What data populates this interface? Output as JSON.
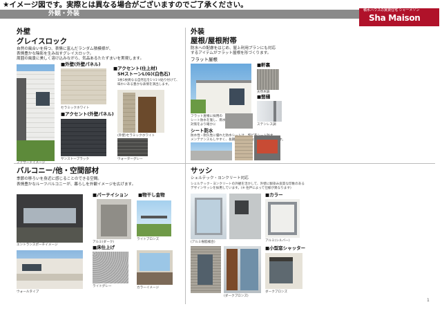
{
  "header": {
    "notice": "★イメージ図です。実際とは異なる場合がございますのでご了承ください。",
    "section_title": "外観・外装",
    "brand_sub": "積水ハウスの賃貸住宅 シャーメゾン",
    "brand_name": "Sha Maison"
  },
  "wall": {
    "heading": "外壁",
    "subheading": "グレイスロック",
    "desc": [
      "自然の風合いを持つ、表情に富んだランダム積模様が、",
      "表情豊かな陰影を生み出すグレイスロック。",
      "周囲の風景に美しく溶け込みながら、気品あるたたずまいを実現します。"
    ],
    "photo_caption": "ファサードイメージ",
    "panel1_label": "■外壁(外壁パネル)",
    "panel1_caption": "セラミックホワイト",
    "panel2_label": "■アクセント(外壁パネル)",
    "panel2_caption": "サンストーブラック",
    "accent_label": "■アクセント(仕上材)",
    "accent_sub": "SHストーンL(G)(白色石)",
    "accent_desc": [
      "1枚1枚異なる自然石を1つ1つ貼り付けて、",
      "味わいある豊かな表情を演出します。"
    ],
    "door_caption": "(外壁)セラミックホワイト",
    "stone_caption": "ウォーターグレー"
  },
  "roof": {
    "heading": "外装",
    "subheading": "屋根/屋根附帯",
    "desc": [
      "防水への配慮をはじめ、屋上利用プランにも対応",
      "するアイテムがフラット屋根を形づくります。"
    ],
    "flat_label": "フラット屋根",
    "eaves_label": "■軒裏",
    "eaves_caption": "天然木調",
    "gutter_label": "■竪樋",
    "gutter_caption": "ステンレス調",
    "flat_note": [
      "フラット屋根に採用の",
      "シート防水を施し、雨水",
      "対策をより確かに"
    ],
    "sheet_label": "シート防水",
    "sheet_desc": [
      "防水性・耐久性に優れた防水シートは、塩ビ系シート防水",
      "メンテナンスもしやすく、長期にわたって防水性能を維持します。"
    ]
  },
  "balcony": {
    "heading": "バルコニー/他・空間部材",
    "desc": [
      "季節の移ろいを身近に感じることのできる空間。",
      "表情豊かなルーフバルコニーが、暮らしを外観イメージを広げます。"
    ],
    "caption1": "エントランスポーチイメージ",
    "partition_label": "■パーテイション",
    "partition_caption": "アルミ(ダーク)",
    "fixture_label": "■物干し金物",
    "fixture_caption": "ライトブロンズ",
    "floor_label": "■床仕上げ",
    "floor_caption": "ライトグレー",
    "railing_label": "ウォールタイプ",
    "veranda_caption": "カラーイメージ"
  },
  "sash": {
    "heading": "サッシ",
    "subheading": "シェルテック・ヨンクリート対応",
    "desc": [
      "シェルテック・ヨンクリートの外観を活かして、外壁に馴染み良質な印象のある",
      "デザインサッシを採用しています。(※ 住戸によって仕様が異なります)"
    ],
    "color_label": "■カラー",
    "color_caption": "アルミ(シルバー)",
    "shutter_label": "■小型窓シャッター",
    "shutter_caption": "ダークブロンズ",
    "caption1": "(アルミ樹脂複合)",
    "caption2": "(ダークブロンズ)"
  },
  "page_no": "1"
}
